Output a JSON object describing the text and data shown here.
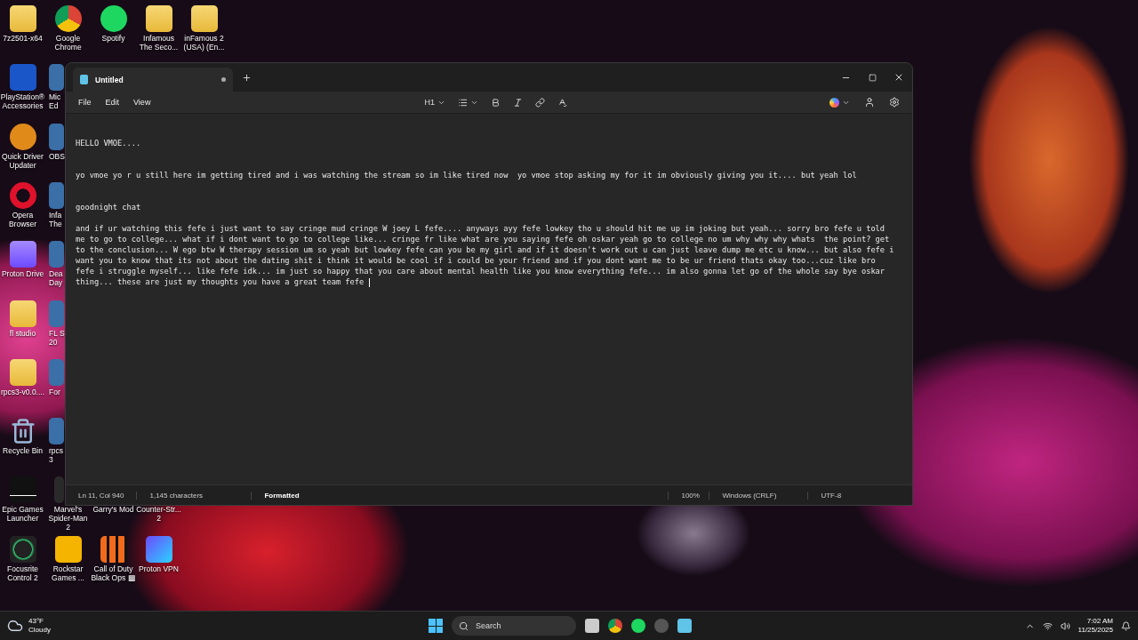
{
  "desktop_icons": [
    {
      "label": "7z2501-x64",
      "kind": "folder"
    },
    {
      "label": "Google Chrome",
      "kind": "chrome"
    },
    {
      "label": "Spotify",
      "kind": "spotify"
    },
    {
      "label": "Infamous The Seco...",
      "kind": "folder"
    },
    {
      "label": "inFamous 2 (USA) (En...",
      "kind": "folder"
    },
    {
      "label": "PlayStation® Accessories",
      "kind": "blue"
    },
    {
      "label": "Mic Ed",
      "kind": "partial"
    },
    {
      "label": "Quick Driver Updater",
      "kind": "gear"
    },
    {
      "label": "OBS",
      "kind": "partial"
    },
    {
      "label": "Opera Browser",
      "kind": "opera"
    },
    {
      "label": "Infa The",
      "kind": "partial"
    },
    {
      "label": "Proton Drive",
      "kind": "purple"
    },
    {
      "label": "Dea Day",
      "kind": "partial"
    },
    {
      "label": "fl studio",
      "kind": "folder"
    },
    {
      "label": "FL S 20",
      "kind": "partial"
    },
    {
      "label": "rpcs3-v0.0....",
      "kind": "folder"
    },
    {
      "label": "For",
      "kind": "partial"
    },
    {
      "label": "Recycle Bin",
      "kind": "recycle"
    },
    {
      "label": "rpcs3",
      "kind": "partial"
    },
    {
      "label": "Epic Games Launcher",
      "kind": "epic"
    },
    {
      "label": "Marvel's Spider-Man 2",
      "kind": "dark"
    },
    {
      "label": "Garry's Mod",
      "kind": "hidden"
    },
    {
      "label": "Counter-Str... 2",
      "kind": "hidden"
    },
    {
      "label": "Focusrite Control 2",
      "kind": "ring"
    },
    {
      "label": "Rockstar Games ...",
      "kind": "rockstar"
    },
    {
      "label": "Call of Duty Black Ops ▩",
      "kind": "cod"
    },
    {
      "label": "Proton VPN",
      "kind": "vpn"
    }
  ],
  "window": {
    "tab": {
      "title": "Untitled",
      "unsaved": true
    },
    "menu": [
      "File",
      "Edit",
      "View"
    ],
    "toolbar": {
      "heading": "H1"
    },
    "document": [
      {
        "lines": [
          "HELLO VMOE...."
        ]
      },
      {
        "lines": [
          "yo vmoe yo r u still here im getting tired and i was watching the stream so im like tired now  yo vmoe stop asking my for it im obviously giving you it.... but yeah lol"
        ]
      },
      {
        "lines": [
          "goodnight chat"
        ]
      },
      {
        "lines": [
          "and if ur watching this fefe i just want to say cringe mud cringe W joey L fefe.... anyways ayy fefe lowkey tho u should hit me up im joking but yeah... sorry bro fefe u told",
          "me to go to college... what if i dont want to go to college like... cringe fr like what are you saying fefe oh oskar yeah go to college no um why why why whats  the point? get",
          "to the conclusion... W ego btw W therapy session um so yeah but lowkey fefe can you be my girl and if it doesn't work out u can just leave dump me etc u know... but also fefe i",
          "want you to know that its not about the dating shit i think it would be cool if i could be your friend and if you dont want me to be ur friend thats okay too...cuz like bro",
          "fefe i struggle myself... like fefe idk... im just so happy that you care about mental health like you know everything fefe... im also gonna let go of the whole say bye oskar",
          "thing... these are just my thoughts you have a great team fefe "
        ]
      }
    ],
    "status_bar": {
      "position": "Ln 11, Col 940",
      "characters": "1,145 characters",
      "format": "Formatted",
      "zoom": "100%",
      "line_endings": "Windows (CRLF)",
      "encoding": "UTF-8"
    }
  },
  "taskbar": {
    "weather": {
      "temperature": "43°F",
      "condition": "Cloudy"
    },
    "search": {
      "placeholder": "Search"
    },
    "time": "7:02 AM",
    "date": "11/25/2025"
  }
}
